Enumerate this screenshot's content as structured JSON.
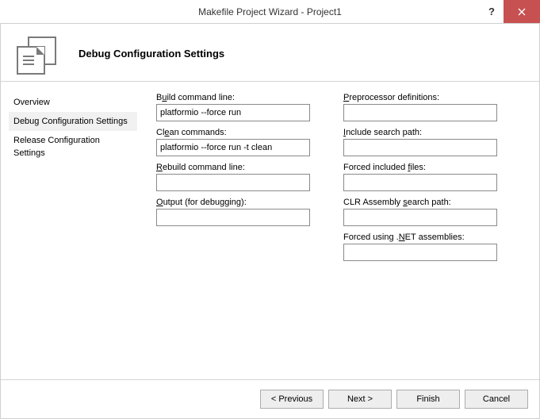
{
  "window": {
    "title": "Makefile Project Wizard - Project1"
  },
  "header": {
    "title": "Debug Configuration Settings"
  },
  "sidebar": {
    "items": [
      {
        "label": "Overview"
      },
      {
        "label": "Debug Configuration Settings"
      },
      {
        "label": "Release Configuration Settings"
      }
    ],
    "selected_index": 1
  },
  "fields": {
    "build_cmd": {
      "label_pre": "B",
      "label_ul": "u",
      "label_post": "ild command line:",
      "value": "platformio --force run"
    },
    "clean_cmd": {
      "label_pre": "Cl",
      "label_ul": "e",
      "label_post": "an commands:",
      "value": "platformio --force run -t clean"
    },
    "rebuild_cmd": {
      "label_pre": "",
      "label_ul": "R",
      "label_post": "ebuild command line:",
      "value": ""
    },
    "output": {
      "label_pre": "",
      "label_ul": "O",
      "label_post": "utput (for debugging):",
      "value": ""
    },
    "preprocessor": {
      "label_pre": "",
      "label_ul": "P",
      "label_post": "reprocessor definitions:",
      "value": ""
    },
    "include_path": {
      "label_pre": "",
      "label_ul": "I",
      "label_post": "nclude search path:",
      "value": ""
    },
    "forced_included": {
      "label_pre": "Forced included ",
      "label_ul": "f",
      "label_post": "iles:",
      "value": ""
    },
    "clr_path": {
      "label_pre": "CLR Assembly ",
      "label_ul": "s",
      "label_post": "earch path:",
      "value": ""
    },
    "forced_net": {
      "label_pre": "Forced using .",
      "label_ul": "N",
      "label_post": "ET assemblies:",
      "value": ""
    }
  },
  "footer": {
    "previous": "< Previous",
    "next": "Next >",
    "finish": "Finish",
    "cancel": "Cancel"
  }
}
